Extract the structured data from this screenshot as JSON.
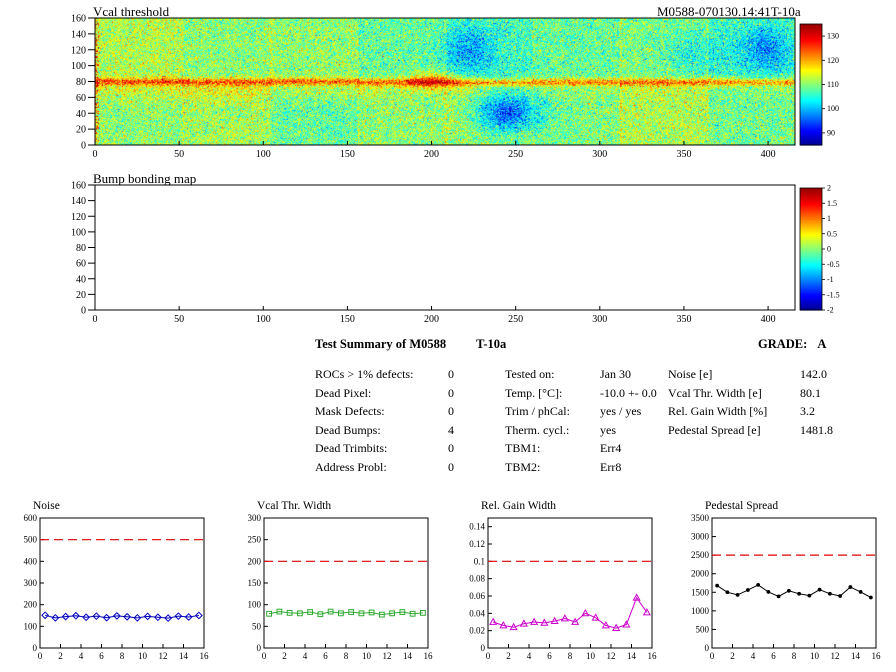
{
  "summary": {
    "title": "Test Summary of M0588",
    "subtitle": "T-10a",
    "grade_label": "GRADE:",
    "grade": "A",
    "left": [
      {
        "label": "ROCs > 1% defects:",
        "value": "0"
      },
      {
        "label": "Dead Pixel:",
        "value": "0"
      },
      {
        "label": "Mask Defects:",
        "value": "0"
      },
      {
        "label": "Dead Bumps:",
        "value": "4"
      },
      {
        "label": "Dead Trimbits:",
        "value": "0"
      },
      {
        "label": "Address Probl:",
        "value": "0"
      }
    ],
    "middle": [
      {
        "label": "Tested on:",
        "value": "Jan 30"
      },
      {
        "label": "Temp. [°C]:",
        "value": "-10.0 +- 0.0"
      },
      {
        "label": "Trim / phCal:",
        "value": "yes / yes"
      },
      {
        "label": "Therm. cycl.:",
        "value": "yes"
      },
      {
        "label": "TBM1:",
        "value": "Err4"
      },
      {
        "label": "TBM2:",
        "value": "Err8"
      }
    ],
    "right": [
      {
        "label": "Noise [e]",
        "value": "142.0"
      },
      {
        "label": "Vcal Thr. Width [e]",
        "value": "80.1"
      },
      {
        "label": "Rel. Gain Width [%]",
        "value": "3.2"
      },
      {
        "label": "Pedestal Spread [e]",
        "value": "1481.8"
      }
    ]
  },
  "chart_data": [
    {
      "type": "heatmap",
      "title": "Vcal threshold",
      "right_title": "M0588-070130.14:41T-10a",
      "xlim": [
        0,
        416
      ],
      "ylim": [
        0,
        160
      ],
      "x_ticks": [
        0,
        50,
        100,
        150,
        200,
        250,
        300,
        350,
        400
      ],
      "y_ticks": [
        0,
        20,
        40,
        60,
        80,
        100,
        120,
        140,
        160
      ],
      "colorbar": {
        "range": [
          85,
          135
        ],
        "ticks": [
          90,
          100,
          110,
          120,
          130
        ]
      },
      "base_value": 110,
      "description": "Per-pixel Vcal threshold map, 416x160 pixels (16 ROCs, 8 columns x 2 rows). Mostly ~105-115 (green/cyan speckle) with an elevated yellow band along the chip boundary at row 80, an orange hotspot near x=200 y=80, and low-threshold blue patches near x=245 (bottom half), x=222 (top half), x=355 and x=398 (top right), plus scattered high values on the left edge column."
    },
    {
      "type": "heatmap",
      "title": "Bump bonding map",
      "xlim": [
        0,
        416
      ],
      "ylim": [
        0,
        160
      ],
      "x_ticks": [
        0,
        50,
        100,
        150,
        200,
        250,
        300,
        350,
        400
      ],
      "y_ticks": [
        0,
        20,
        40,
        60,
        80,
        100,
        120,
        140,
        160
      ],
      "colorbar": {
        "range": [
          -2,
          2
        ],
        "ticks": [
          2,
          1.5,
          1,
          0.5,
          0,
          -0.5,
          -1,
          -1.5,
          -2
        ]
      },
      "empty": true,
      "description": "Empty (no entries displayed) bump bonding defect map; white interior with rainbow color scale from -2 to 2."
    },
    {
      "type": "line",
      "title": "Noise",
      "xlim": [
        0,
        16
      ],
      "x_ticks": [
        0,
        2,
        4,
        6,
        8,
        10,
        12,
        14,
        16
      ],
      "ylim": [
        0,
        600
      ],
      "y_ticks": [
        0,
        100,
        200,
        300,
        400,
        500,
        600
      ],
      "cut_line": 500,
      "color": "#0000bb",
      "marker": "diamond",
      "x_centers": [
        0.5,
        1.5,
        2.5,
        3.5,
        4.5,
        5.5,
        6.5,
        7.5,
        8.5,
        9.5,
        10.5,
        11.5,
        12.5,
        13.5,
        14.5,
        15.5
      ],
      "values": [
        151,
        139,
        145,
        149,
        142,
        147,
        140,
        148,
        144,
        139,
        146,
        142,
        138,
        147,
        143,
        150
      ]
    },
    {
      "type": "line",
      "title": "Vcal Thr. Width",
      "xlim": [
        0,
        16
      ],
      "x_ticks": [
        0,
        2,
        4,
        6,
        8,
        10,
        12,
        14,
        16
      ],
      "ylim": [
        0,
        300
      ],
      "y_ticks": [
        0,
        50,
        100,
        150,
        200,
        250,
        300
      ],
      "cut_line": 200,
      "color": "#2faa2f",
      "marker": "square",
      "x_centers": [
        0.5,
        1.5,
        2.5,
        3.5,
        4.5,
        5.5,
        6.5,
        7.5,
        8.5,
        9.5,
        10.5,
        11.5,
        12.5,
        13.5,
        14.5,
        15.5
      ],
      "values": [
        79,
        84,
        81,
        80,
        83,
        78,
        84,
        80,
        83,
        80,
        82,
        77,
        80,
        83,
        79,
        81
      ]
    },
    {
      "type": "line",
      "title": "Rel. Gain Width",
      "xlim": [
        0,
        16
      ],
      "x_ticks": [
        0,
        2,
        4,
        6,
        8,
        10,
        12,
        14,
        16
      ],
      "ylim": [
        0,
        0.15
      ],
      "y_ticks": [
        0,
        0.02,
        0.04,
        0.06,
        0.08,
        0.1,
        0.12,
        0.14
      ],
      "cut_line": 0.1,
      "color": "#cc00cc",
      "marker": "triangle",
      "x_centers": [
        0.5,
        1.5,
        2.5,
        3.5,
        4.5,
        5.5,
        6.5,
        7.5,
        8.5,
        9.5,
        10.5,
        11.5,
        12.5,
        13.5,
        14.5,
        15.5
      ],
      "values": [
        0.03,
        0.026,
        0.024,
        0.028,
        0.03,
        0.029,
        0.031,
        0.034,
        0.03,
        0.04,
        0.035,
        0.026,
        0.023,
        0.027,
        0.058,
        0.041
      ]
    },
    {
      "type": "line",
      "title": "Pedestal Spread",
      "xlim": [
        0,
        16
      ],
      "x_ticks": [
        0,
        2,
        4,
        6,
        8,
        10,
        12,
        14,
        16
      ],
      "ylim": [
        0,
        3500
      ],
      "y_ticks": [
        0,
        500,
        1000,
        1500,
        2000,
        2500,
        3000,
        3500
      ],
      "cut_line": 2500,
      "color": "#000000",
      "marker": "dot",
      "x_centers": [
        0.5,
        1.5,
        2.5,
        3.5,
        4.5,
        5.5,
        6.5,
        7.5,
        8.5,
        9.5,
        10.5,
        11.5,
        12.5,
        13.5,
        14.5,
        15.5
      ],
      "values": [
        1680,
        1500,
        1430,
        1560,
        1700,
        1510,
        1390,
        1540,
        1460,
        1410,
        1570,
        1460,
        1400,
        1640,
        1510,
        1360
      ]
    }
  ]
}
